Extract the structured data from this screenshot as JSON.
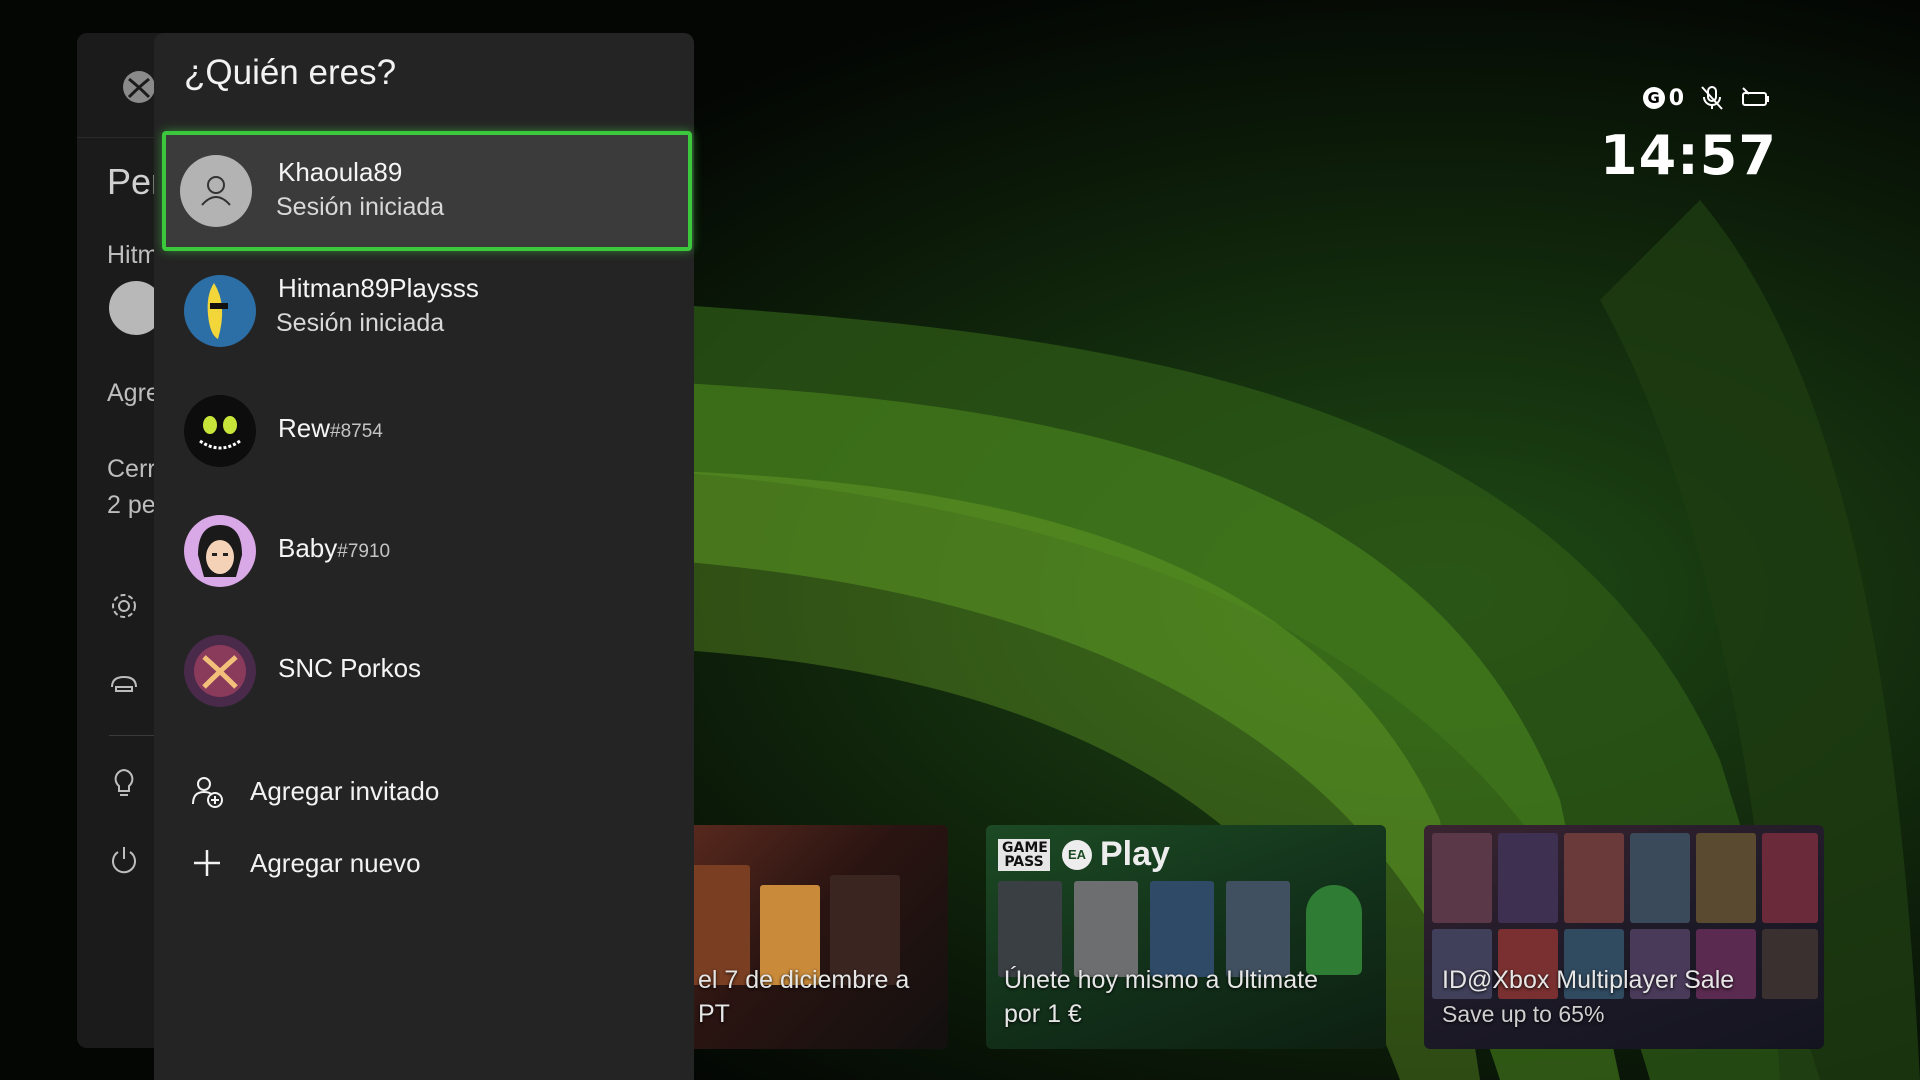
{
  "status": {
    "gamerscore": "0",
    "time": "14:57"
  },
  "sidebar": {
    "heading_partial": "Per",
    "user_partial": "Hitm",
    "add_partial": "Agre",
    "signout_partial": "Cerr",
    "signout_count_partial": "2 pe"
  },
  "panel": {
    "title": "¿Quién eres?",
    "profiles": [
      {
        "name": "Khaoula89",
        "tag": "",
        "status": "Sesión iniciada"
      },
      {
        "name": "Hitman89Playsss",
        "tag": "",
        "status": "Sesión iniciada"
      },
      {
        "name": "Rew",
        "tag": "#8754",
        "status": ""
      },
      {
        "name": "Baby",
        "tag": "#7910",
        "status": ""
      },
      {
        "name": "SNC Porkos",
        "tag": "",
        "status": ""
      }
    ],
    "actions": [
      {
        "label": "Agregar invitado",
        "icon": "add-guest-icon"
      },
      {
        "label": "Agregar nuevo",
        "icon": "plus-icon"
      }
    ]
  },
  "tiles": [
    {
      "caption": "el 7 de diciembre a",
      "caption2": "PT"
    },
    {
      "logo_box": "GAME PASS",
      "logo_text": "Play",
      "caption": "Únete hoy mismo a Ultimate",
      "caption2": "por 1 €"
    },
    {
      "caption": "ID@Xbox Multiplayer Sale",
      "subcaption": "Save up to 65%"
    }
  ],
  "colors": {
    "accent": "#3cc83c",
    "panel": "#242424",
    "sidebar": "#1b1b1b"
  }
}
